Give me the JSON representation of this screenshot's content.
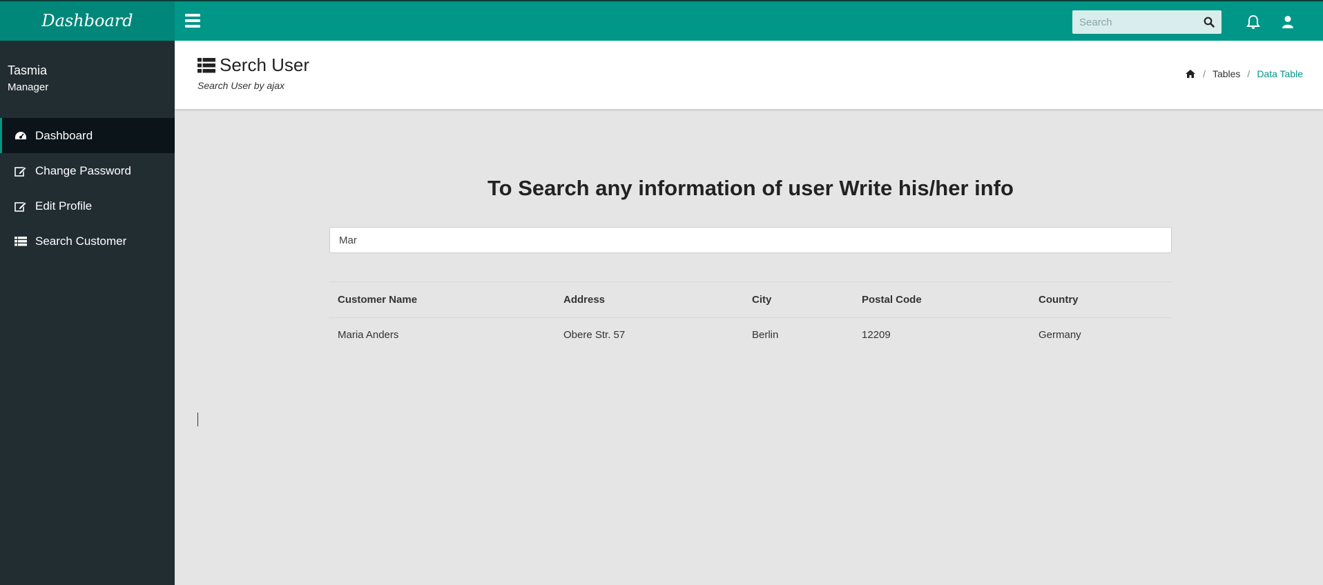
{
  "brand": "Dashboard",
  "top_search": {
    "placeholder": "Search"
  },
  "user": {
    "name": "Tasmia",
    "role": "Manager"
  },
  "sidebar": {
    "items": [
      {
        "label": "Dashboard",
        "icon": "dashboard-icon",
        "active": true
      },
      {
        "label": "Change Password",
        "icon": "edit-icon"
      },
      {
        "label": "Edit Profile",
        "icon": "edit-icon"
      },
      {
        "label": "Search Customer",
        "icon": "table-list-icon"
      }
    ]
  },
  "header": {
    "title": "Serch User",
    "subtitle": "Search User by ajax",
    "breadcrumb": {
      "home_icon": "home-icon",
      "tables": "Tables",
      "current": "Data Table"
    }
  },
  "main": {
    "heading": "To Search any information of user Write his/her info",
    "search_value": "Mar"
  },
  "table": {
    "columns": [
      "Customer Name",
      "Address",
      "City",
      "Postal Code",
      "Country"
    ],
    "rows": [
      [
        "Maria Anders",
        "Obere Str. 57",
        "Berlin",
        "12209",
        "Germany"
      ]
    ]
  },
  "colors": {
    "accent": "#009688",
    "sidebar": "#222d32",
    "sidebar_active": "#0b1519",
    "content_bg": "#e5e5e5"
  }
}
